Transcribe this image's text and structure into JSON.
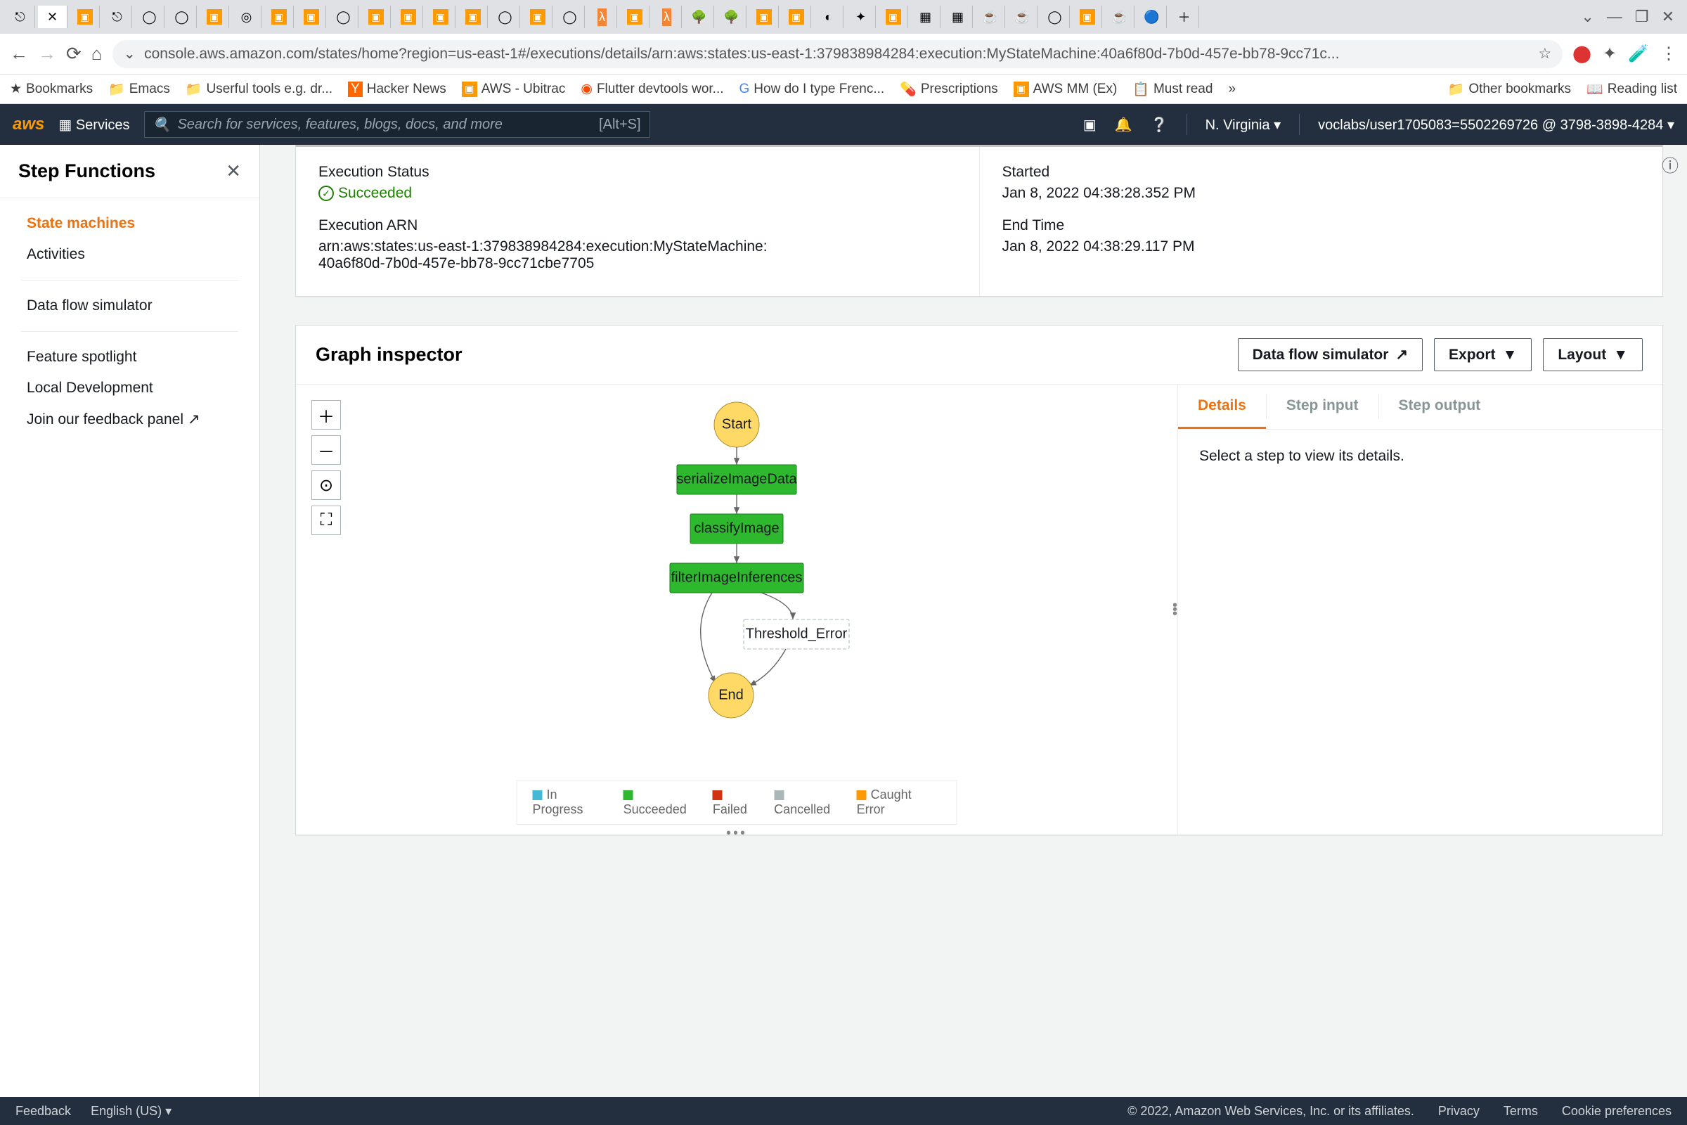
{
  "browser": {
    "url": "console.aws.amazon.com/states/home?region=us-east-1#/executions/details/arn:aws:states:us-east-1:379838984284:execution:MyStateMachine:40a6f80d-7b0d-457e-bb78-9cc71c...",
    "bookmarks": {
      "title": "Bookmarks",
      "items": [
        "Emacs",
        "Userful tools e.g. dr...",
        "Hacker News",
        "AWS - Ubitrac",
        "Flutter devtools wor...",
        "How do I type Frenc...",
        "Prescriptions",
        "AWS MM (Ex)",
        "Must read"
      ],
      "other": "Other bookmarks",
      "reading": "Reading list"
    }
  },
  "aws_nav": {
    "services": "Services",
    "search_placeholder": "Search for services, features, blogs, docs, and more",
    "shortcut": "[Alt+S]",
    "region": "N. Virginia",
    "account": "voclabs/user1705083=5502269726 @ 3798-3898-4284"
  },
  "sidebar": {
    "title": "Step Functions",
    "items": [
      "State machines",
      "Activities",
      "Data flow simulator",
      "Feature spotlight",
      "Local Development",
      "Join our feedback panel"
    ]
  },
  "status": {
    "exec_status_label": "Execution Status",
    "exec_status_value": "Succeeded",
    "exec_arn_label": "Execution ARN",
    "exec_arn_value": "arn:aws:states:us-east-1:379838984284:execution:MyStateMachine:40a6f80d-7b0d-457e-bb78-9cc71cbe7705",
    "started_label": "Started",
    "started_value": "Jan 8, 2022 04:38:28.352 PM",
    "end_label": "End Time",
    "end_value": "Jan 8, 2022 04:38:29.117 PM"
  },
  "graph": {
    "title": "Graph inspector",
    "actions": {
      "simulator": "Data flow simulator",
      "export": "Export",
      "layout": "Layout"
    },
    "nodes": {
      "start": "Start",
      "serialize": "serializeImageData",
      "classify": "classifyImage",
      "filter": "filterImageInferences",
      "error": "Threshold_Error",
      "end": "End"
    },
    "legend": [
      "In Progress",
      "Succeeded",
      "Failed",
      "Cancelled",
      "Caught Error"
    ],
    "legend_colors": [
      "#44b9d6",
      "#2db82d",
      "#d13212",
      "#aab7b8",
      "#ff9900"
    ]
  },
  "details": {
    "tabs": [
      "Details",
      "Step input",
      "Step output"
    ],
    "placeholder": "Select a step to view its details."
  },
  "footer": {
    "feedback": "Feedback",
    "lang": "English (US)",
    "copyright": "© 2022, Amazon Web Services, Inc. or its affiliates.",
    "links": [
      "Privacy",
      "Terms",
      "Cookie preferences"
    ]
  }
}
